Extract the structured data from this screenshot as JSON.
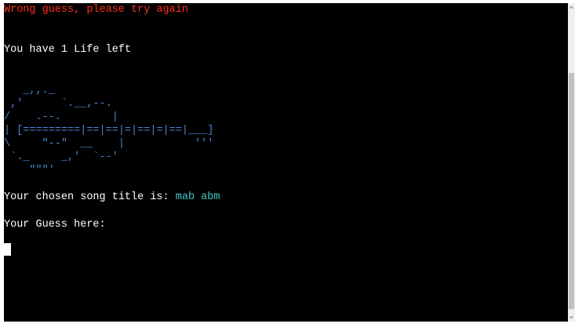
{
  "terminal": {
    "error_message": "Wrong guess, please try again",
    "lives_message": "You have 1 Life left",
    "guitar_art": [
      "   _,,._",
      " ,'      `.__,--.",
      "/    .--.        |",
      "| [=========|==|==|=|==|=|==|___]",
      "\\     \"--\"  __    |           '''",
      " `._     _,'  `--'",
      "    \"\"\"'"
    ],
    "song_title_label": "Your chosen song title is: ",
    "song_title_value": "mab abm",
    "guess_prompt": "Your Guess here: "
  },
  "colors": {
    "background": "#000000",
    "text": "#ffffff",
    "error": "#ff2f1f",
    "art": "#4a86d6",
    "song": "#3ec7c7"
  },
  "icons": {
    "scroll_up": "scroll-up-arrow-icon",
    "scroll_down": "scroll-down-arrow-icon"
  }
}
